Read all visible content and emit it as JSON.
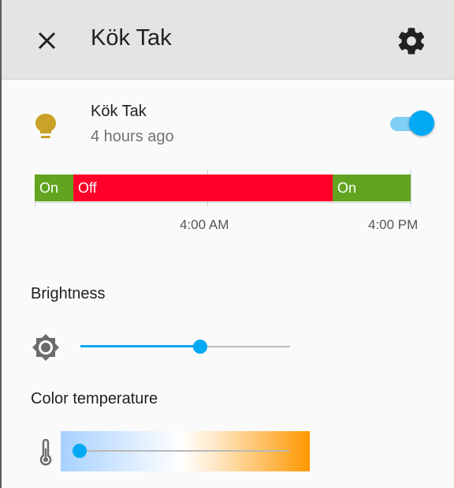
{
  "dialog": {
    "title": "Kök Tak",
    "close_icon": "close-icon",
    "settings_icon": "gear-icon"
  },
  "entity": {
    "icon": "lightbulb-icon",
    "icon_color": "#c9a227",
    "name": "Kök Tak",
    "last_changed": "4 hours ago",
    "state_toggle": "on"
  },
  "history": {
    "segments": [
      {
        "state": "On",
        "color": "#62a420"
      },
      {
        "state": "Off",
        "color": "#ff0029"
      },
      {
        "state": "On",
        "color": "#62a420"
      }
    ],
    "time_labels": [
      "4:00 AM",
      "4:00 PM"
    ]
  },
  "brightness": {
    "label": "Brightness",
    "icon": "brightness-icon",
    "value_fraction": 0.57,
    "accent": "#03a9f4"
  },
  "color_temp": {
    "label": "Color temperature",
    "icon": "thermometer-icon",
    "value_fraction": 0.0
  }
}
